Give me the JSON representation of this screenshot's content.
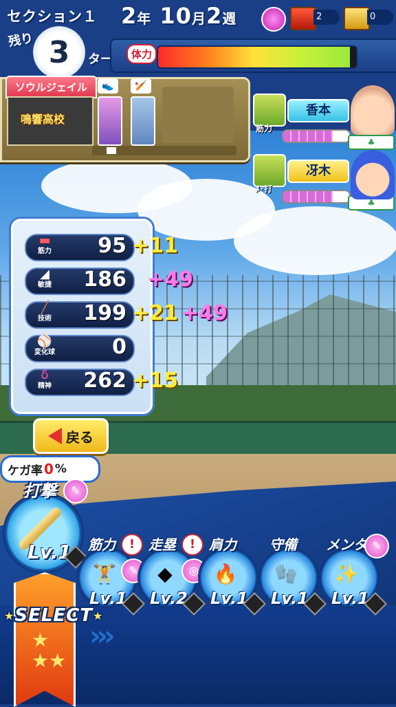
{
  "header": {
    "section_label": "セクション１",
    "remaining_label": "残り",
    "turns_remaining": "3",
    "turn_label": "ターン",
    "date_year": "2",
    "date_year_unit": "年",
    "date_month": "10",
    "date_month_unit": "月",
    "date_week": "2",
    "date_week_unit": "週",
    "red_chest_count": "2",
    "gold_chest_count": "0",
    "stamina_label": "体力",
    "stamina_fraction": 0.97
  },
  "school_panel": {
    "tab_label": "ソウルジェイル",
    "school_name": "鳴響高校",
    "equipped_items": [
      "shoe-icon",
      "bat-icon"
    ],
    "scroll_position": 0.05
  },
  "partners": [
    {
      "name": "香本",
      "type": "筋力",
      "icon": "dumbbell-icon",
      "bond_fraction": 0.75,
      "plate_color": "#36c2e6"
    },
    {
      "name": "冴木",
      "type": "ﾒ･打",
      "icon": "bat-icon",
      "bond_fraction": 0.75,
      "plate_color": "#f0c21a"
    }
  ],
  "stats": [
    {
      "label": "筋力",
      "icon": "dumbbell-icon",
      "value": "95",
      "bonuses": [
        "+11"
      ],
      "bonus_colors": [
        "yellow"
      ]
    },
    {
      "label": "敏捷",
      "icon": "shoe-icon",
      "value": "186",
      "bonuses": [
        "+49"
      ],
      "bonus_colors": [
        "pink"
      ]
    },
    {
      "label": "技術",
      "icon": "bat-icon",
      "value": "199",
      "bonuses": [
        "+21",
        "+49"
      ],
      "bonus_colors": [
        "yellow",
        "pink"
      ]
    },
    {
      "label": "変化球",
      "icon": "baseball-icon",
      "value": "0",
      "bonuses": [],
      "bonus_colors": []
    },
    {
      "label": "精神",
      "icon": "spirit-icon",
      "value": "262",
      "bonuses": [
        "+15"
      ],
      "bonus_colors": [
        "yellow"
      ]
    }
  ],
  "back_button": {
    "label": "戻る"
  },
  "injury": {
    "label": "ケガ率",
    "value": "0",
    "unit": "%"
  },
  "practice": {
    "main": {
      "title": "打撃",
      "level": "Lv.1",
      "icon": "bat-icon"
    },
    "items": [
      {
        "title": "筋力",
        "level": "Lv.1",
        "icon": "dumbbell-icon",
        "alert": "!"
      },
      {
        "title": "走塁",
        "level": "Lv.2",
        "icon": "base-icon",
        "alert": "!"
      },
      {
        "title": "肩力",
        "level": "Lv.1",
        "icon": "fire-ball-icon",
        "alert": ""
      },
      {
        "title": "守備",
        "level": "Lv.1",
        "icon": "glove-icon",
        "alert": ""
      },
      {
        "title": "メンタ",
        "level": "Lv.1",
        "icon": "sparkle-icon",
        "alert": ""
      }
    ]
  },
  "select": {
    "label": "SELECT"
  },
  "colors": {
    "accent_blue": "#1b3f86",
    "stamina_low": "#ff2a2a",
    "stamina_high": "#9be83a",
    "bonus_yellow": "#ffec3a",
    "bonus_pink": "#ff7ae8"
  }
}
